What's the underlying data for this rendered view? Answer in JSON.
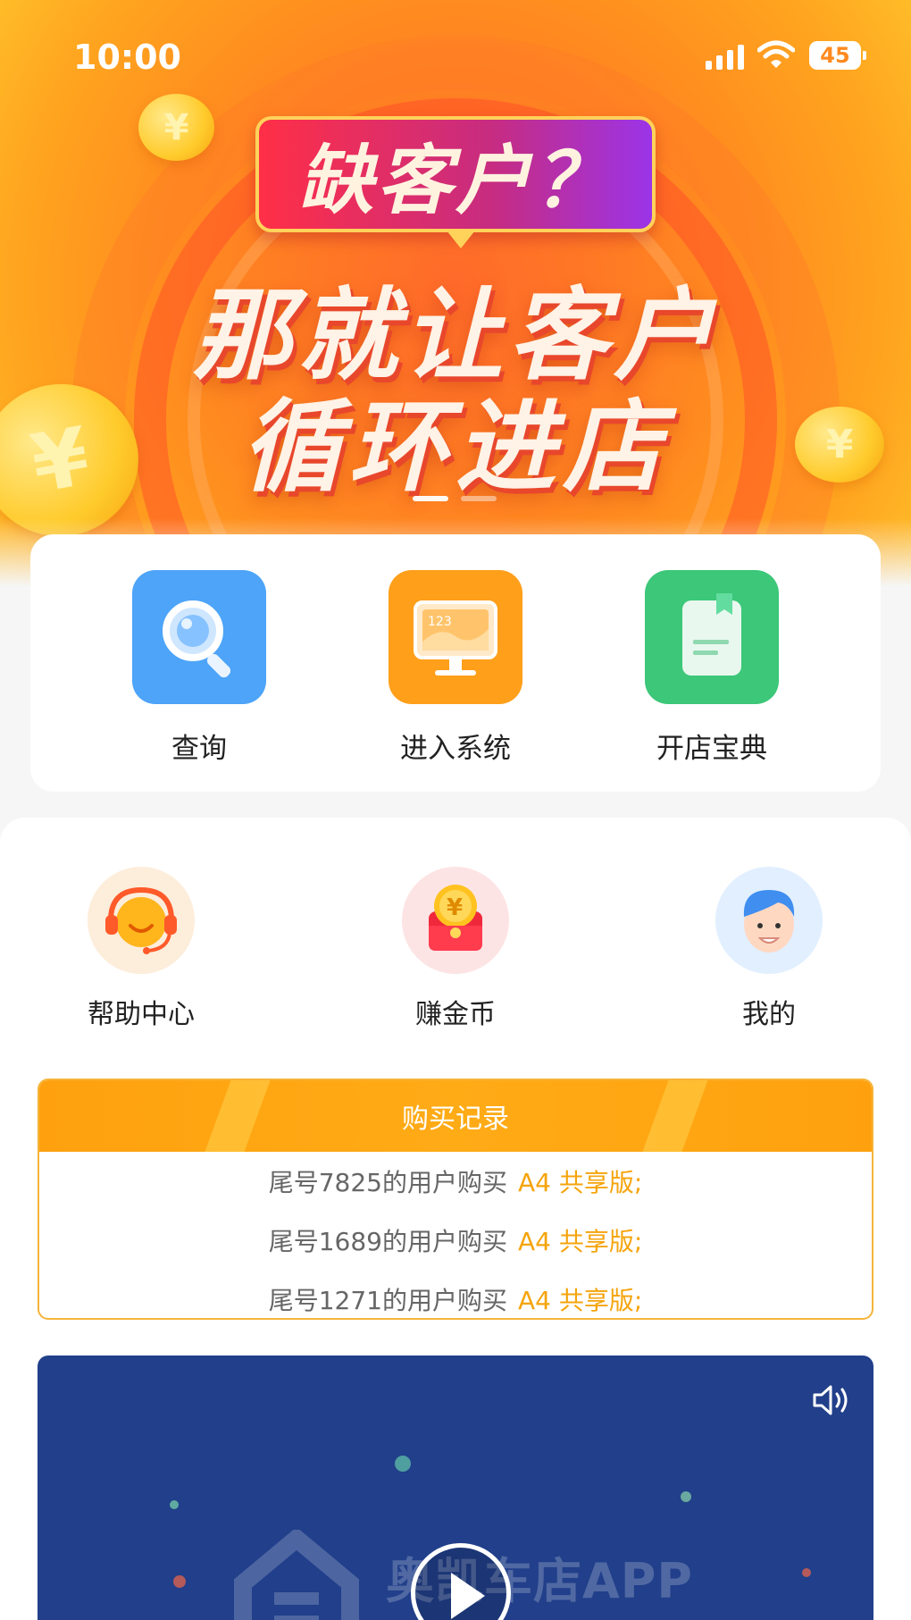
{
  "status_bar": {
    "time": "10:00",
    "battery": "45"
  },
  "banner": {
    "question": "缺客户？",
    "headline_line1": "那就让客户",
    "headline_line2": "循环进店",
    "coin_symbol": "¥",
    "active_slide": 1,
    "slide_count": 2
  },
  "main_menu": [
    {
      "label": "查询",
      "icon": "magnifier-icon",
      "color": "#4da4f8"
    },
    {
      "label": "进入系统",
      "icon": "monitor-chart-icon",
      "color": "#ff9f1a"
    },
    {
      "label": "开店宝典",
      "icon": "book-icon",
      "color": "#3cc779"
    }
  ],
  "secondary_menu": [
    {
      "label": "帮助中心",
      "icon": "headset-support-icon"
    },
    {
      "label": "赚金币",
      "icon": "gold-coin-wallet-icon"
    },
    {
      "label": "我的",
      "icon": "user-avatar-icon"
    }
  ],
  "records": {
    "title": "购买记录",
    "rows": [
      {
        "text": "尾号7825的用户购买",
        "product": "A4 共享版;"
      },
      {
        "text": "尾号1689的用户购买",
        "product": "A4 共享版;"
      },
      {
        "text": "尾号1271的用户购买",
        "product": "A4 共享版;"
      }
    ]
  },
  "video": {
    "title": "奥凯车店APP",
    "background": "#213f8a"
  },
  "monitor_text": "123"
}
